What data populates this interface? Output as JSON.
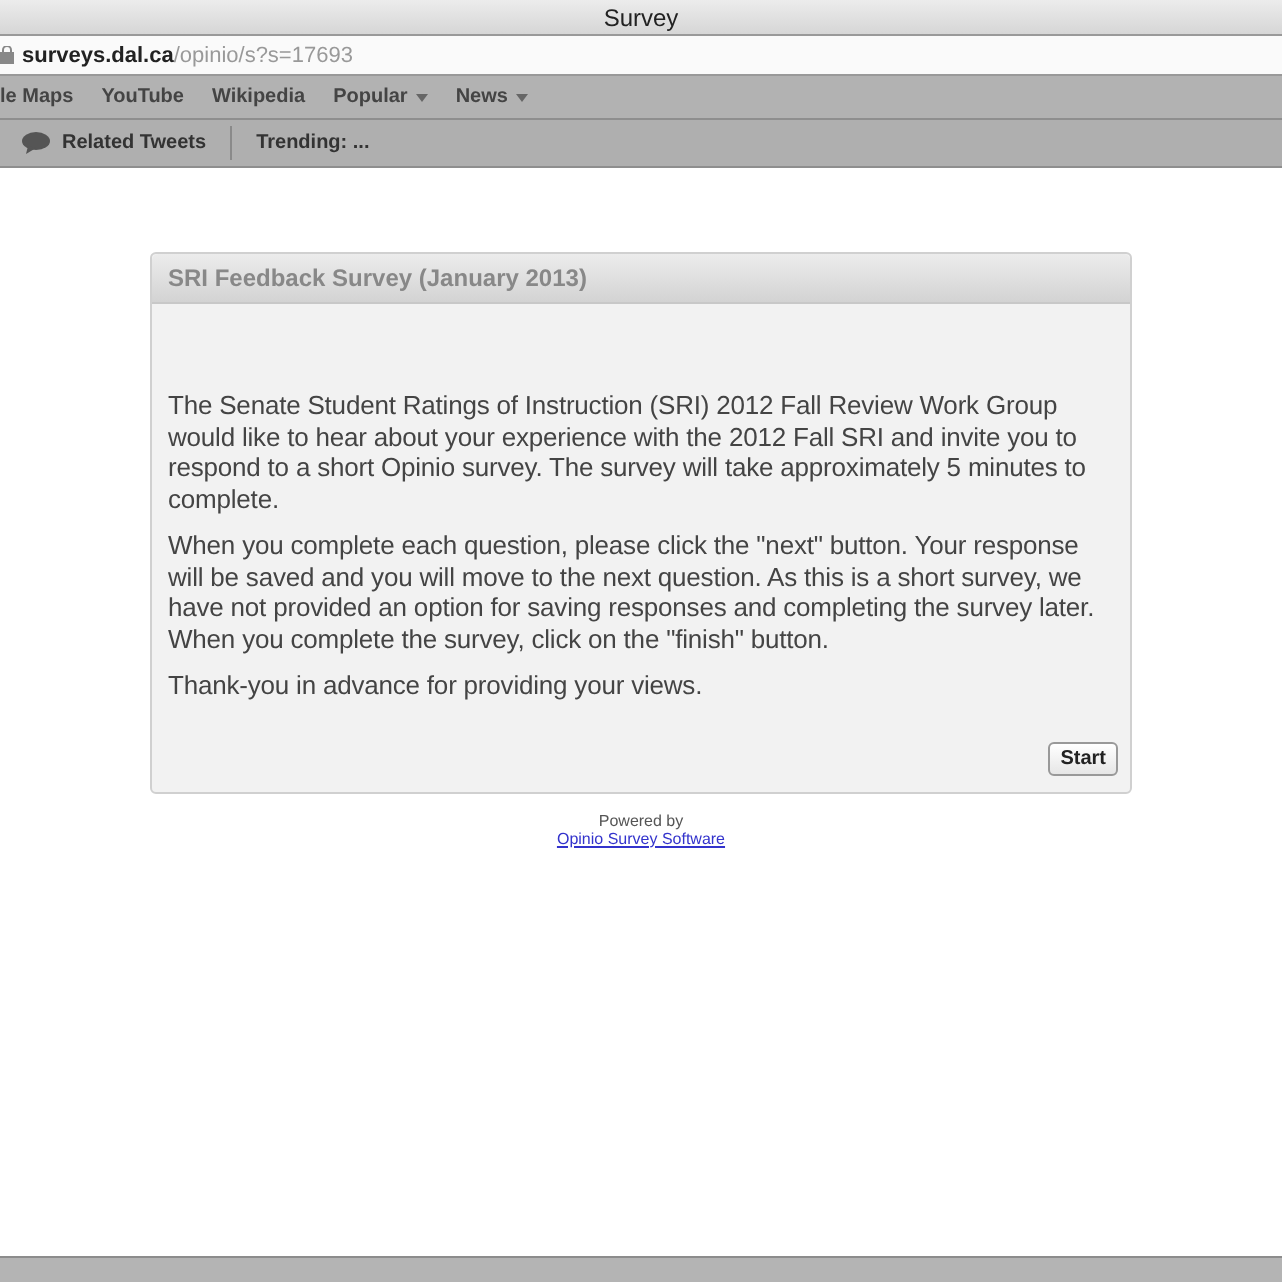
{
  "window": {
    "title": "Survey"
  },
  "address_bar": {
    "host": "surveys.dal.ca",
    "path": "/opinio/s?s=17693"
  },
  "bookmarks": [
    {
      "label": "le Maps",
      "menu": false
    },
    {
      "label": "YouTube",
      "menu": false
    },
    {
      "label": "Wikipedia",
      "menu": false
    },
    {
      "label": "Popular",
      "menu": true
    },
    {
      "label": "News",
      "menu": true
    }
  ],
  "toolbar": {
    "related": "Related Tweets",
    "trending": "Trending: ..."
  },
  "survey": {
    "title": "SRI Feedback Survey (January 2013)",
    "paragraphs": [
      "The Senate Student Ratings of Instruction (SRI) 2012 Fall Review Work Group would like to hear about your experience with the 2012 Fall SRI and invite you to respond to a short Opinio survey. The survey will take approximately 5 minutes to complete.",
      "When you complete each question, please click the \"next\" button. Your response will be saved and you will move to the next question. As this is a short survey, we have not provided an option for saving responses and completing the survey later. When you complete the survey, click on the \"finish\" button.",
      "Thank-you in advance for providing your views."
    ],
    "button": "Start"
  },
  "footer": {
    "powered_by": "Powered by",
    "link": "Opinio Survey Software"
  }
}
